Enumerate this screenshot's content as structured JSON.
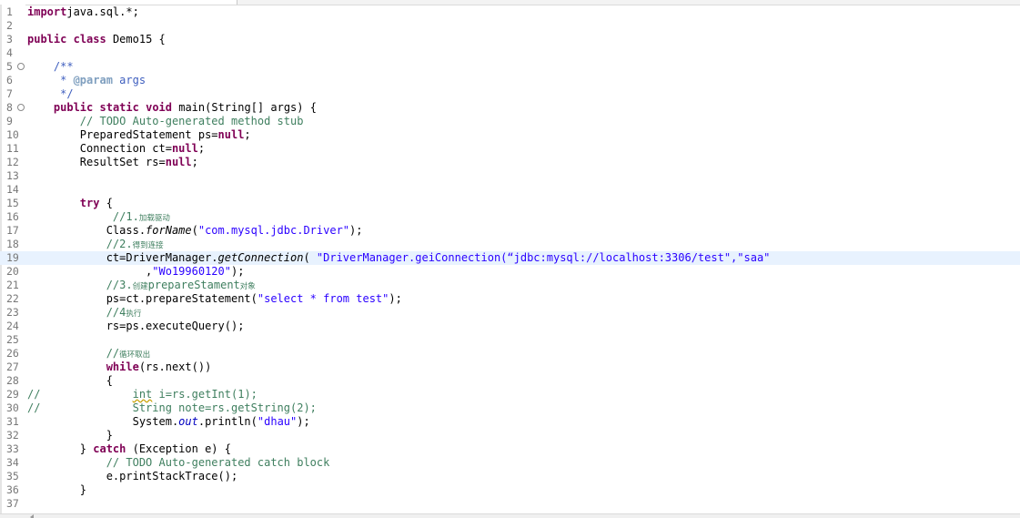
{
  "editor": {
    "lines": [
      {
        "n": "1",
        "parts": [
          [
            "kw",
            "import"
          ],
          [
            "",
            "java.sql.*;"
          ]
        ]
      },
      {
        "n": "2",
        "parts": []
      },
      {
        "n": "3",
        "parts": [
          [
            "kw",
            "public"
          ],
          [
            "",
            " "
          ],
          [
            "kw",
            "class"
          ],
          [
            "",
            " Demo15 {"
          ]
        ]
      },
      {
        "n": "4",
        "parts": []
      },
      {
        "n": "5",
        "fold": "⊖",
        "parts": [
          [
            "",
            "    "
          ],
          [
            "jd",
            "/**"
          ]
        ]
      },
      {
        "n": "6",
        "parts": [
          [
            "",
            "     "
          ],
          [
            "jd",
            "* "
          ],
          [
            "jdtag",
            "@param"
          ],
          [
            "jd",
            " args"
          ]
        ]
      },
      {
        "n": "7",
        "parts": [
          [
            "",
            "     "
          ],
          [
            "jd",
            "*/"
          ]
        ]
      },
      {
        "n": "8",
        "fold": "⊖",
        "parts": [
          [
            "",
            "    "
          ],
          [
            "kw",
            "public"
          ],
          [
            "",
            " "
          ],
          [
            "kw",
            "static"
          ],
          [
            "",
            " "
          ],
          [
            "kw",
            "void"
          ],
          [
            "",
            " main(String[] args) {"
          ]
        ]
      },
      {
        "n": "9",
        "parts": [
          [
            "",
            "        "
          ],
          [
            "cm",
            "// TODO Auto-generated method stub"
          ]
        ]
      },
      {
        "n": "10",
        "parts": [
          [
            "",
            "        PreparedStatement ps="
          ],
          [
            "kw",
            "null"
          ],
          [
            "",
            ";"
          ]
        ]
      },
      {
        "n": "11",
        "parts": [
          [
            "",
            "        Connection ct="
          ],
          [
            "kw",
            "null"
          ],
          [
            "",
            ";"
          ]
        ]
      },
      {
        "n": "12",
        "parts": [
          [
            "",
            "        ResultSet rs="
          ],
          [
            "kw",
            "null"
          ],
          [
            "",
            ";"
          ]
        ]
      },
      {
        "n": "13",
        "parts": []
      },
      {
        "n": "14",
        "parts": []
      },
      {
        "n": "15",
        "parts": [
          [
            "",
            "        "
          ],
          [
            "kw",
            "try"
          ],
          [
            "",
            " {"
          ]
        ]
      },
      {
        "n": "16",
        "parts": [
          [
            "",
            "             "
          ],
          [
            "cm",
            "//1."
          ],
          [
            "cm cjk",
            "加载驱动"
          ]
        ]
      },
      {
        "n": "17",
        "parts": [
          [
            "",
            "            Class."
          ],
          [
            "it",
            "forName"
          ],
          [
            "",
            "("
          ],
          [
            "str",
            "\"com.mysql.jdbc.Driver\""
          ],
          [
            "",
            ");"
          ]
        ]
      },
      {
        "n": "18",
        "parts": [
          [
            "",
            "            "
          ],
          [
            "cm",
            "//2."
          ],
          [
            "cm cjk",
            "得到连接"
          ]
        ]
      },
      {
        "n": "19",
        "hl": true,
        "parts": [
          [
            "",
            "            ct=DriverManager."
          ],
          [
            "it",
            "getConnection"
          ],
          [
            "",
            "( "
          ],
          [
            "str",
            "\"DriverManager.geiConnection(“jdbc:mysql://localhost:3306/test\",\"saa\""
          ]
        ]
      },
      {
        "n": "20",
        "parts": [
          [
            "",
            "                  ,"
          ],
          [
            "str",
            "\"Wo19960120\""
          ],
          [
            "",
            ");"
          ]
        ]
      },
      {
        "n": "21",
        "parts": [
          [
            "",
            "            "
          ],
          [
            "cm",
            "//3."
          ],
          [
            "cm cjk",
            "创建"
          ],
          [
            "cm",
            "prepareStament"
          ],
          [
            "cm cjk",
            "对象"
          ]
        ]
      },
      {
        "n": "22",
        "parts": [
          [
            "",
            "            ps=ct.prepareStatement("
          ],
          [
            "str",
            "\"select * from test\""
          ],
          [
            "",
            ");"
          ]
        ]
      },
      {
        "n": "23",
        "parts": [
          [
            "",
            "            "
          ],
          [
            "cm",
            "//4"
          ],
          [
            "cm cjk",
            "执行"
          ]
        ]
      },
      {
        "n": "24",
        "parts": [
          [
            "",
            "            rs=ps.executeQuery();"
          ]
        ]
      },
      {
        "n": "25",
        "parts": []
      },
      {
        "n": "26",
        "parts": [
          [
            "",
            "            "
          ],
          [
            "cm",
            "//"
          ],
          [
            "cm cjk",
            "循环取出"
          ]
        ]
      },
      {
        "n": "27",
        "parts": [
          [
            "",
            "            "
          ],
          [
            "kw",
            "while"
          ],
          [
            "",
            "(rs.next())"
          ]
        ]
      },
      {
        "n": "28",
        "parts": [
          [
            "",
            "            {"
          ]
        ]
      },
      {
        "n": "29",
        "parts": [
          [
            "cm",
            "//"
          ],
          [
            "cm",
            "              "
          ],
          [
            "cm warn",
            "int"
          ],
          [
            "cm",
            " i=rs.getInt(1);"
          ]
        ]
      },
      {
        "n": "30",
        "parts": [
          [
            "cm",
            "//"
          ],
          [
            "cm",
            "              String note=rs.getString(2);"
          ]
        ]
      },
      {
        "n": "31",
        "parts": [
          [
            "",
            "                System."
          ],
          [
            "fld",
            "out"
          ],
          [
            "",
            ".println("
          ],
          [
            "str",
            "\"dhau\""
          ],
          [
            "",
            ");"
          ]
        ]
      },
      {
        "n": "32",
        "parts": [
          [
            "",
            "            }"
          ]
        ]
      },
      {
        "n": "33",
        "parts": [
          [
            "",
            "        } "
          ],
          [
            "kw",
            "catch"
          ],
          [
            "",
            " (Exception e) {"
          ]
        ]
      },
      {
        "n": "34",
        "parts": [
          [
            "",
            "            "
          ],
          [
            "cm",
            "// TODO Auto-generated catch block"
          ]
        ]
      },
      {
        "n": "35",
        "parts": [
          [
            "",
            "            e.printStackTrace();"
          ]
        ]
      },
      {
        "n": "36",
        "parts": [
          [
            "",
            "        }"
          ]
        ]
      },
      {
        "n": "37",
        "parts": []
      }
    ]
  }
}
